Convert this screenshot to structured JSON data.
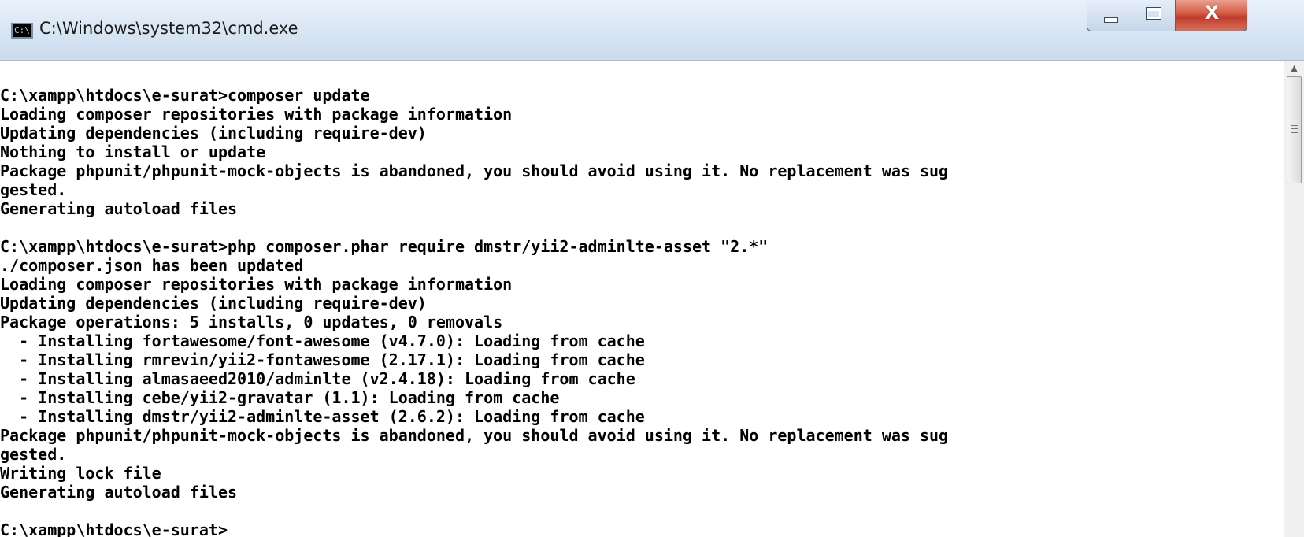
{
  "window": {
    "title": "C:\\Windows\\system32\\cmd.exe",
    "icon_text": "C:\\",
    "buttons": {
      "minimize": "minimize",
      "maximize": "maximize",
      "close": "X"
    }
  },
  "console": {
    "lines": [
      "",
      "C:\\xampp\\htdocs\\e-surat>composer update",
      "Loading composer repositories with package information",
      "Updating dependencies (including require-dev)",
      "Nothing to install or update",
      "Package phpunit/phpunit-mock-objects is abandoned, you should avoid using it. No replacement was sug",
      "gested.",
      "Generating autoload files",
      "",
      "C:\\xampp\\htdocs\\e-surat>php composer.phar require dmstr/yii2-adminlte-asset \"2.*\"",
      "./composer.json has been updated",
      "Loading composer repositories with package information",
      "Updating dependencies (including require-dev)",
      "Package operations: 5 installs, 0 updates, 0 removals",
      "  - Installing fortawesome/font-awesome (v4.7.0): Loading from cache",
      "  - Installing rmrevin/yii2-fontawesome (2.17.1): Loading from cache",
      "  - Installing almasaeed2010/adminlte (v2.4.18): Loading from cache",
      "  - Installing cebe/yii2-gravatar (1.1): Loading from cache",
      "  - Installing dmstr/yii2-adminlte-asset (2.6.2): Loading from cache",
      "Package phpunit/phpunit-mock-objects is abandoned, you should avoid using it. No replacement was sug",
      "gested.",
      "Writing lock file",
      "Generating autoload files",
      "",
      "C:\\xampp\\htdocs\\e-surat>"
    ]
  },
  "scrollbar": {
    "up_arrow": "▲",
    "grip_icon": "grip-icon"
  },
  "colors": {
    "console_background": "#ffffff",
    "console_text": "#000000",
    "close_button": "#c0392b",
    "titlebar": "#dbe7f4"
  }
}
